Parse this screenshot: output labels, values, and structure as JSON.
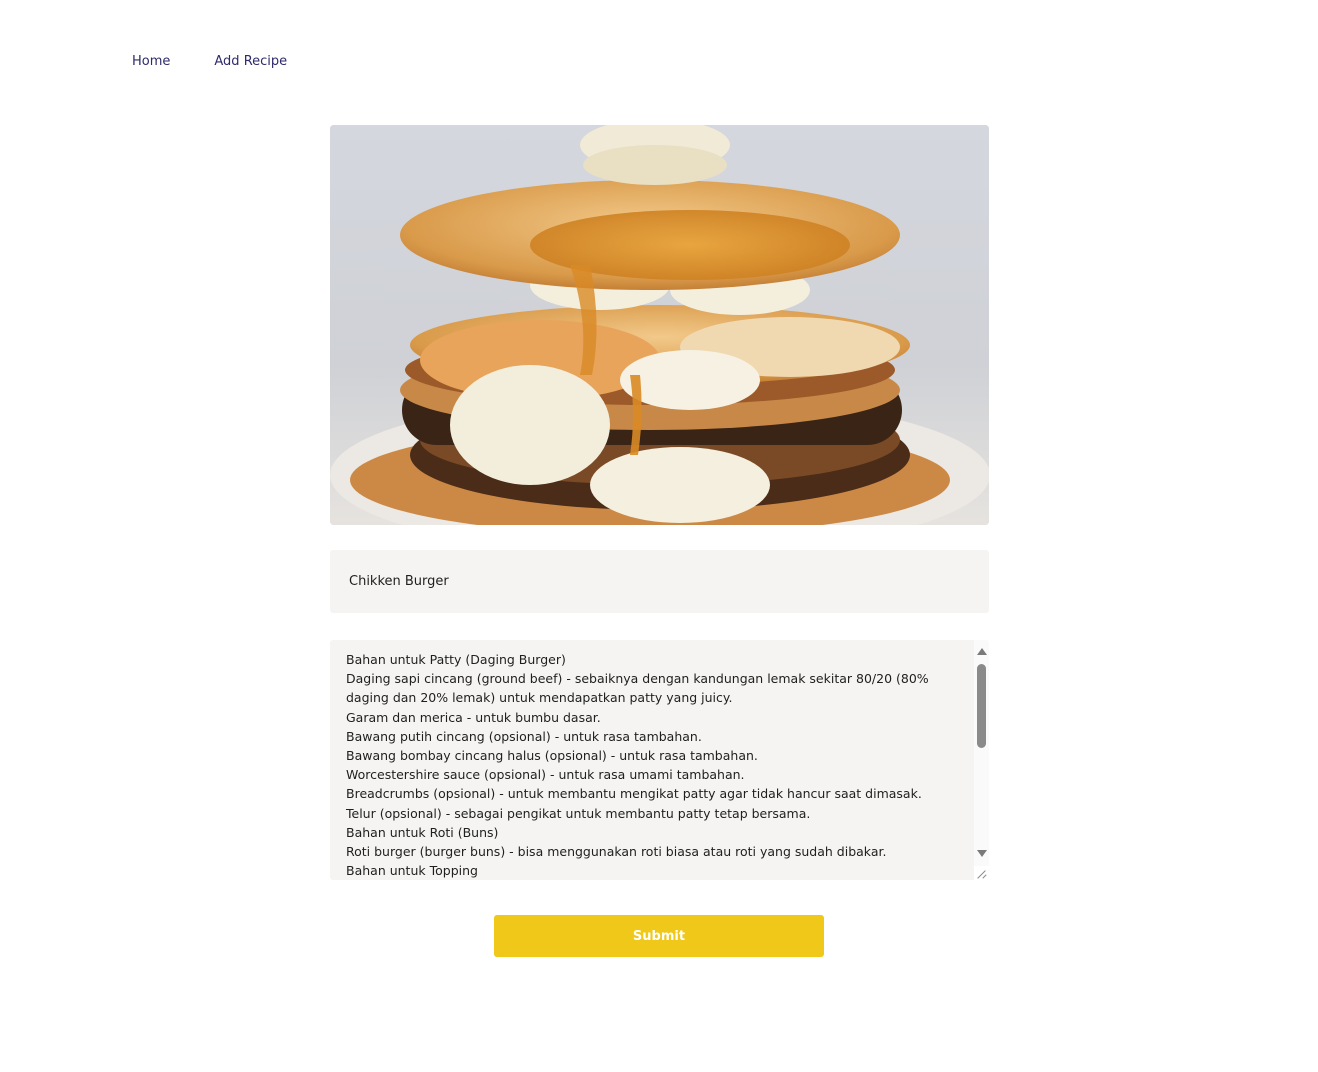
{
  "nav": {
    "home_label": "Home",
    "add_recipe_label": "Add Recipe"
  },
  "form": {
    "title_value": "Chikken Burger",
    "description_lines": [
      "Bahan untuk Patty (Daging Burger)",
      "Daging sapi cincang (ground beef) - sebaiknya dengan kandungan lemak sekitar 80/20 (80% daging dan 20% lemak) untuk mendapatkan patty yang juicy.",
      "Garam dan merica - untuk bumbu dasar.",
      "Bawang putih cincang (opsional) - untuk rasa tambahan.",
      "Bawang bombay cincang halus (opsional) - untuk rasa tambahan.",
      "Worcestershire sauce (opsional) - untuk rasa umami tambahan.",
      "Breadcrumbs (opsional) - untuk membantu mengikat patty agar tidak hancur saat dimasak.",
      "Telur (opsional) - sebagai pengikat untuk membantu patty tetap bersama.",
      "Bahan untuk Roti (Buns)",
      "Roti burger (burger buns) - bisa menggunakan roti biasa atau roti yang sudah dibakar.",
      "Bahan untuk Topping"
    ],
    "submit_label": "Submit"
  },
  "colors": {
    "accent": "#efc81a",
    "nav_link": "#2e2a6b",
    "field_bg": "#f5f4f2"
  }
}
